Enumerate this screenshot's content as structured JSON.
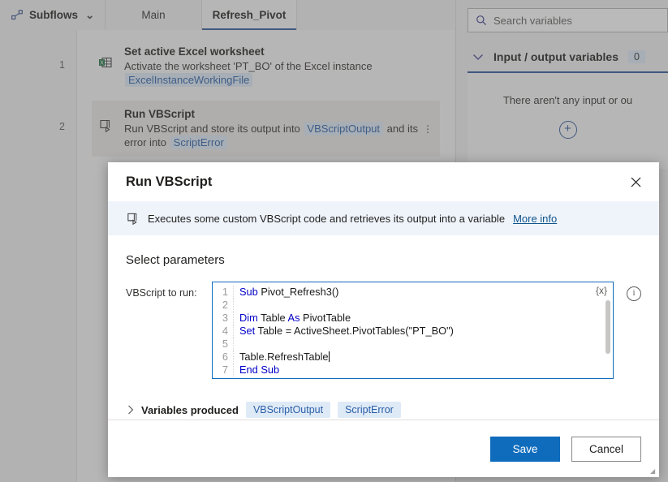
{
  "background": {
    "subflows_button": {
      "label": "Subflows",
      "icon": "flow-nodes-icon",
      "chevron": "⌄"
    },
    "tabs": [
      {
        "label": "Main",
        "active": false
      },
      {
        "label": "Refresh_Pivot",
        "active": true
      }
    ],
    "steps": [
      {
        "number": "1",
        "icon": "excel-worksheet-icon",
        "title": "Set active Excel worksheet",
        "desc_prefix": "Activate the worksheet 'PT_BO' of the Excel instance",
        "chip1": "ExcelInstanceWorkingFile",
        "desc_mid": "",
        "chip2": "",
        "desc_suffix": "",
        "selected": false
      },
      {
        "number": "2",
        "icon": "vbscript-run-icon",
        "title": "Run VBScript",
        "desc_prefix": "Run VBScript and store its output into",
        "chip1": "VBScriptOutput",
        "desc_mid": "and its error into",
        "chip2": "ScriptError",
        "desc_suffix": "",
        "selected": true
      }
    ],
    "variables_pane": {
      "search_placeholder": "Search variables",
      "search_icon": "search-icon",
      "io_section": {
        "chevron_icon": "chevron-down-icon",
        "title": "Input / output variables",
        "count": "0",
        "empty_text": "There aren't any input or ou",
        "add_icon": "plus-circle-icon"
      }
    }
  },
  "dialog": {
    "title": "Run VBScript",
    "close_icon": "close-icon",
    "banner": {
      "icon": "vbscript-run-icon",
      "text": "Executes some custom VBScript code and retrieves its output into a variable",
      "link": "More info"
    },
    "section_title": "Select parameters",
    "field": {
      "label": "VBScript to run:",
      "variable_picker": "{x}",
      "info_icon": "info-icon",
      "code_lines": [
        {
          "n": "1",
          "tokens": [
            {
              "t": "Sub ",
              "k": true
            },
            {
              "t": "Pivot_Refresh3()",
              "k": false
            }
          ]
        },
        {
          "n": "2",
          "tokens": []
        },
        {
          "n": "3",
          "tokens": [
            {
              "t": "Dim ",
              "k": true
            },
            {
              "t": "Table ",
              "k": false
            },
            {
              "t": "As ",
              "k": true
            },
            {
              "t": "PivotTable",
              "k": false
            }
          ]
        },
        {
          "n": "4",
          "tokens": [
            {
              "t": "Set ",
              "k": true
            },
            {
              "t": "Table = ActiveSheet.PivotTables(\"PT_BO\")",
              "k": false
            }
          ]
        },
        {
          "n": "5",
          "tokens": []
        },
        {
          "n": "6",
          "tokens": [
            {
              "t": "Table.RefreshTable",
              "k": false
            }
          ],
          "caret": true
        },
        {
          "n": "7",
          "tokens": [
            {
              "t": "End Sub",
              "k": true
            }
          ]
        }
      ]
    },
    "variables_produced": {
      "chevron_icon": "chevron-right-icon",
      "label": "Variables produced",
      "chips": [
        "VBScriptOutput",
        "ScriptError"
      ]
    },
    "buttons": {
      "save": "Save",
      "cancel": "Cancel"
    }
  },
  "colors": {
    "accent": "#0f6cbd",
    "tab_underline": "#2b579a",
    "chip_bg": "#dfeaf7",
    "chip_text": "#2a5fa8",
    "keyword": "#0000c8",
    "banner_bg": "#eff4fb"
  }
}
